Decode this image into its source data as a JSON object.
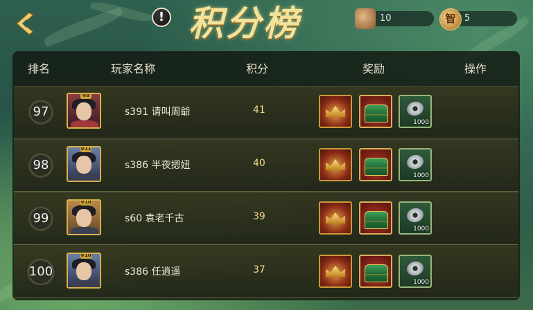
{
  "title": "积分榜",
  "info_icon_glyph": "!",
  "resources": [
    {
      "icon": "scroll-token-icon",
      "value": "10"
    },
    {
      "icon": "wisdom-token-icon",
      "glyph": "智",
      "value": "5"
    }
  ],
  "table": {
    "headers": [
      "排名",
      "玩家名称",
      "积分",
      "奖励",
      "操作"
    ],
    "rows": [
      {
        "rank": "97",
        "vip": "V8",
        "name": "s391 请叫周爺",
        "score": "41",
        "coin_qty": "1000",
        "avatar": "female"
      },
      {
        "rank": "98",
        "vip": "V11",
        "name": "s386 半夜摁妞",
        "score": "40",
        "coin_qty": "1000",
        "avatar": "male"
      },
      {
        "rank": "99",
        "vip": "V10",
        "name": "s60 袁老千古",
        "score": "39",
        "coin_qty": "1000",
        "avatar": "female2"
      },
      {
        "rank": "100",
        "vip": "V10",
        "name": "s386 任逍遥",
        "score": "37",
        "coin_qty": "1000",
        "avatar": "male"
      }
    ]
  },
  "colors": {
    "title_gold": "#f3e29a",
    "score_gold": "#f1d98a",
    "frame_gold": "#d8b24a"
  }
}
